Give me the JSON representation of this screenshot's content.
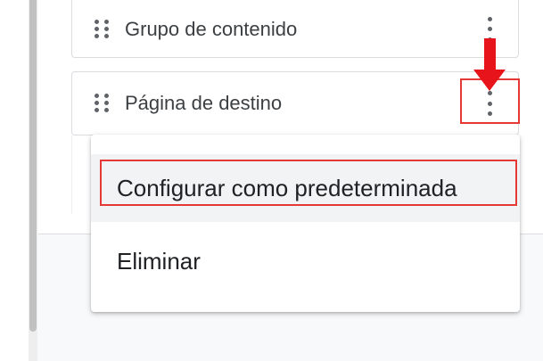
{
  "list": {
    "items": [
      {
        "label": "Grupo de contenido"
      },
      {
        "label": "Página de destino"
      }
    ]
  },
  "menu": {
    "items": [
      {
        "label": "Configurar como predeterminada",
        "highlighted": true
      },
      {
        "label": "Eliminar",
        "highlighted": false
      }
    ]
  },
  "icons": {
    "drag": "drag-handle-icon",
    "more": "more-vert-icon",
    "arrow": "down-arrow-annotation"
  },
  "colors": {
    "annotation_red": "#e53935",
    "arrow_red": "#e8141b",
    "text": "#3c4043",
    "icon_gray": "#5f6368",
    "menu_hover": "#f1f3f4"
  }
}
